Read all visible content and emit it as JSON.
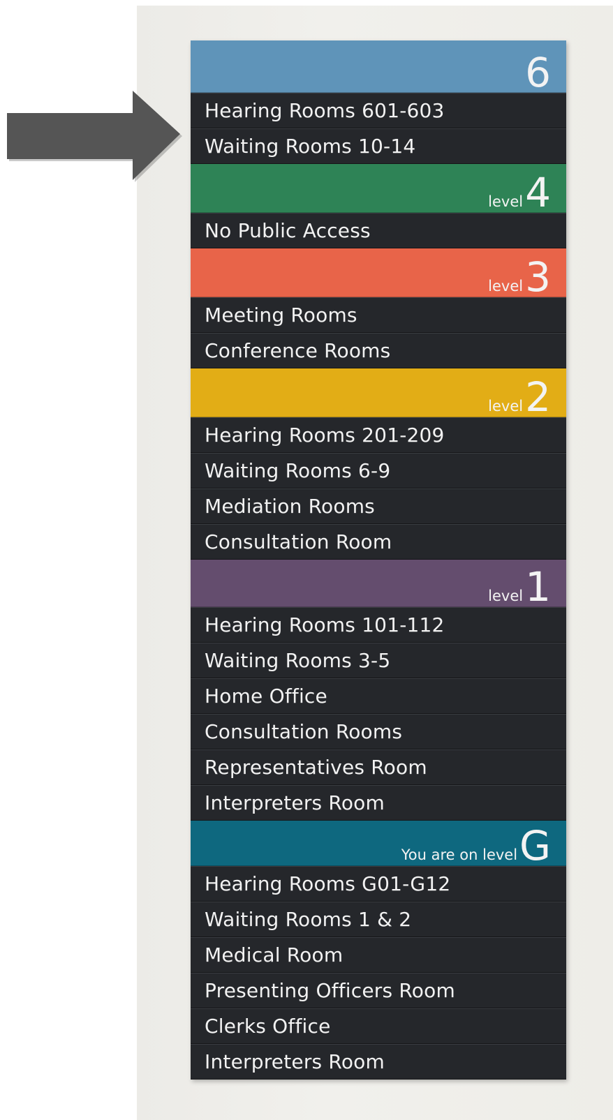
{
  "colors": {
    "level_6": "#5f94b9",
    "level_4": "#2e8356",
    "level_3": "#e86449",
    "level_2": "#e2ad16",
    "level_1": "#644d6e",
    "level_G": "#0e687f",
    "panel": "#25272b",
    "arrow": "#555555"
  },
  "arrow": {
    "icon": "right-arrow-icon"
  },
  "sign": {
    "levels": [
      {
        "key": "6",
        "label": "",
        "number": "6",
        "color": "#5f94b9",
        "rooms": [
          "Hearing Rooms 601-603",
          "Waiting Rooms 10-14"
        ]
      },
      {
        "key": "4",
        "label": "level",
        "number": "4",
        "color": "#2e8356",
        "rooms": [
          "No Public Access"
        ]
      },
      {
        "key": "3",
        "label": "level",
        "number": "3",
        "color": "#e86449",
        "rooms": [
          "Meeting Rooms",
          "Conference Rooms"
        ]
      },
      {
        "key": "2",
        "label": "level",
        "number": "2",
        "color": "#e2ad16",
        "rooms": [
          "Hearing Rooms 201-209",
          "Waiting Rooms 6-9",
          "Mediation Rooms",
          "Consultation Room"
        ]
      },
      {
        "key": "1",
        "label": "level",
        "number": "1",
        "color": "#644d6e",
        "rooms": [
          "Hearing Rooms 101-112",
          "Waiting Rooms 3-5",
          "Home Office",
          "Consultation Rooms",
          "Representatives Room",
          "Interpreters Room"
        ]
      },
      {
        "key": "G",
        "label": "You are on level",
        "number": "G",
        "color": "#0e687f",
        "rooms": [
          "Hearing Rooms G01-G12",
          "Waiting Rooms 1 & 2",
          "Medical Room",
          "Presenting Officers Room",
          "Clerks Office",
          "Interpreters Room"
        ]
      }
    ]
  }
}
